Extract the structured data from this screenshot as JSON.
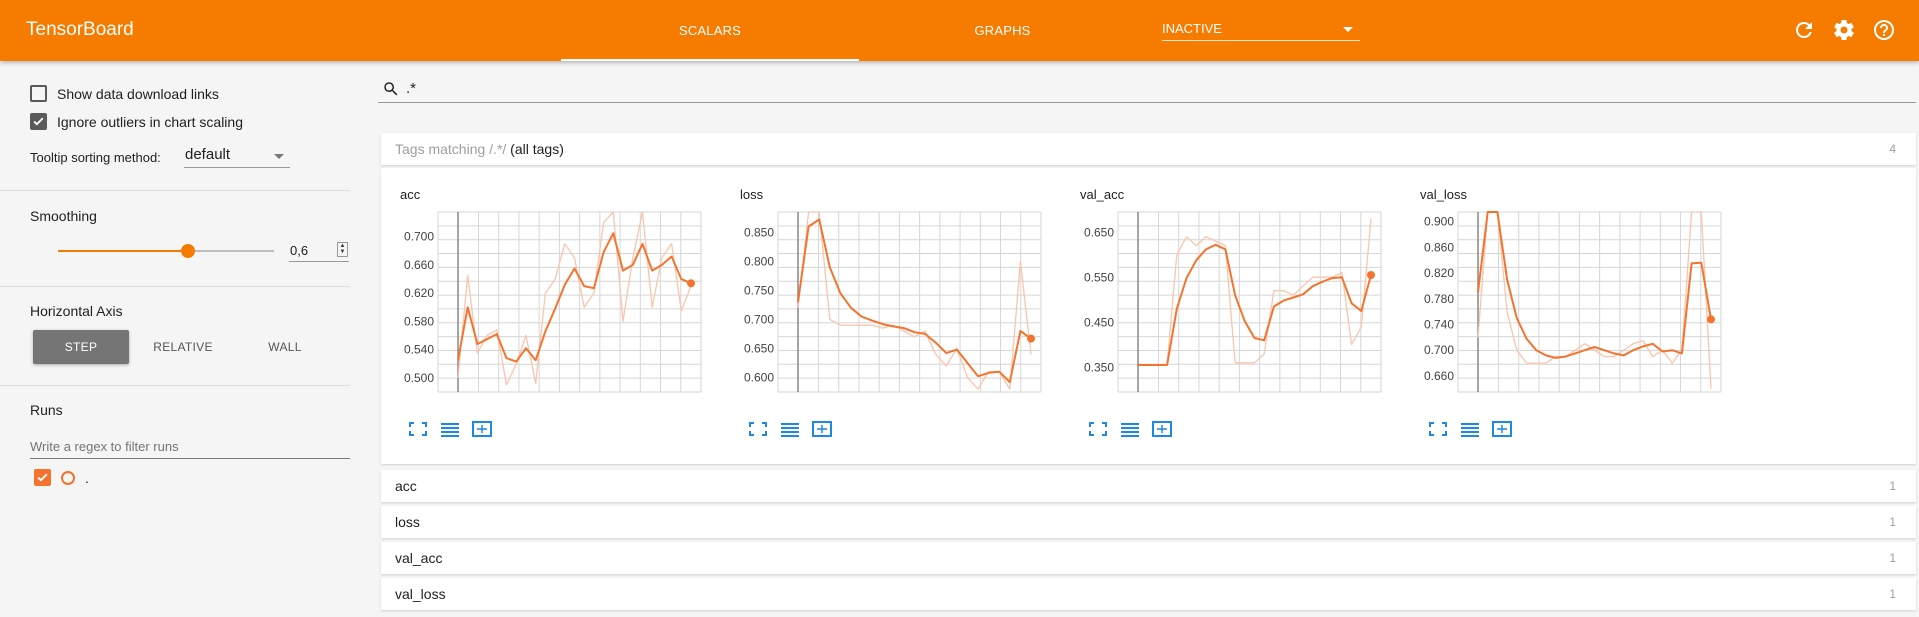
{
  "app": {
    "title": "TensorBoard"
  },
  "nav": {
    "tabs": [
      {
        "label": "SCALARS",
        "active": true
      },
      {
        "label": "GRAPHS",
        "active": false
      }
    ],
    "inactive_select": "INACTIVE",
    "icons": [
      "refresh-icon",
      "settings-icon",
      "help-icon"
    ]
  },
  "colors": {
    "brand": "#f57c00",
    "series": "#f4742f",
    "series_raw": "#fbc4ac"
  },
  "sidebar": {
    "show_download_links": {
      "label": "Show data download links",
      "checked": false
    },
    "ignore_outliers": {
      "label": "Ignore outliers in chart scaling",
      "checked": true
    },
    "tooltip_sorting": {
      "label": "Tooltip sorting method:",
      "value": "default"
    },
    "smoothing": {
      "label": "Smoothing",
      "value": "0,6",
      "fraction": 0.6
    },
    "horizontal_axis": {
      "label": "Horizontal Axis",
      "options": [
        "STEP",
        "RELATIVE",
        "WALL"
      ],
      "selected": "STEP"
    },
    "runs": {
      "label": "Runs",
      "filter_placeholder": "Write a regex to filter runs",
      "items": [
        {
          "name": ".",
          "checked": true
        }
      ]
    }
  },
  "main": {
    "search": ".*",
    "tags_header": {
      "prefix": "Tags matching ",
      "regex": "/.*/",
      "suffix": " (all tags)",
      "count": "4"
    },
    "categories": [
      {
        "name": "acc",
        "count": "1"
      },
      {
        "name": "loss",
        "count": "1"
      },
      {
        "name": "val_acc",
        "count": "1"
      },
      {
        "name": "val_loss",
        "count": "1"
      }
    ]
  },
  "chart_data": [
    {
      "type": "line",
      "title": "acc",
      "yticks": [
        "0.700",
        "0.660",
        "0.620",
        "0.580",
        "0.540",
        "0.500"
      ],
      "ylim": [
        0.48,
        0.735
      ],
      "series": [
        {
          "values": [
            0.525,
            0.6,
            0.548,
            0.555,
            0.562,
            0.528,
            0.523,
            0.542,
            0.525,
            0.566,
            0.598,
            0.632,
            0.655,
            0.63,
            0.627,
            0.678,
            0.705,
            0.652,
            0.66,
            0.69,
            0.652,
            0.66,
            0.672,
            0.64,
            0.634
          ]
        },
        {
          "values": [
            0.5,
            0.645,
            0.535,
            0.56,
            0.568,
            0.49,
            0.52,
            0.56,
            0.492,
            0.62,
            0.64,
            0.69,
            0.67,
            0.6,
            0.62,
            0.72,
            0.735,
            0.58,
            0.67,
            0.735,
            0.6,
            0.67,
            0.69,
            0.595,
            0.63
          ]
        }
      ]
    },
    {
      "type": "line",
      "title": "loss",
      "yticks": [
        "0.850",
        "0.800",
        "0.750",
        "0.700",
        "0.650",
        "0.600"
      ],
      "ylim": [
        0.575,
        0.885
      ],
      "series": [
        {
          "values": [
            0.73,
            0.86,
            0.872,
            0.79,
            0.745,
            0.72,
            0.705,
            0.698,
            0.692,
            0.688,
            0.685,
            0.678,
            0.675,
            0.66,
            0.642,
            0.648,
            0.625,
            0.602,
            0.608,
            0.61,
            0.592,
            0.68,
            0.667
          ]
        },
        {
          "values": [
            0.72,
            0.885,
            0.885,
            0.7,
            0.69,
            0.69,
            0.69,
            0.69,
            0.685,
            0.69,
            0.68,
            0.67,
            0.68,
            0.64,
            0.62,
            0.65,
            0.6,
            0.58,
            0.61,
            0.61,
            0.58,
            0.8,
            0.64
          ]
        }
      ]
    },
    {
      "type": "line",
      "title": "val_acc",
      "yticks": [
        "0.650",
        "0.550",
        "0.450",
        "0.350"
      ],
      "ylim": [
        0.295,
        0.695
      ],
      "series": [
        {
          "values": [
            0.355,
            0.355,
            0.355,
            0.355,
            0.48,
            0.548,
            0.588,
            0.612,
            0.622,
            0.612,
            0.51,
            0.452,
            0.415,
            0.41,
            0.485,
            0.498,
            0.505,
            0.512,
            0.53,
            0.54,
            0.548,
            0.55,
            0.492,
            0.475,
            0.555
          ]
        },
        {
          "values": [
            0.355,
            0.355,
            0.355,
            0.355,
            0.6,
            0.64,
            0.62,
            0.64,
            0.63,
            0.62,
            0.36,
            0.36,
            0.36,
            0.38,
            0.52,
            0.52,
            0.51,
            0.53,
            0.55,
            0.55,
            0.55,
            0.56,
            0.4,
            0.44,
            0.68
          ]
        }
      ]
    },
    {
      "type": "line",
      "title": "val_loss",
      "yticks": [
        "0.900",
        "0.860",
        "0.820",
        "0.780",
        "0.740",
        "0.700",
        "0.660"
      ],
      "ylim": [
        0.635,
        0.915
      ],
      "series": [
        {
          "values": [
            0.79,
            0.915,
            0.915,
            0.81,
            0.75,
            0.718,
            0.7,
            0.692,
            0.688,
            0.69,
            0.695,
            0.7,
            0.705,
            0.7,
            0.695,
            0.692,
            0.7,
            0.706,
            0.71,
            0.698,
            0.7,
            0.695,
            0.835,
            0.836,
            0.748
          ]
        },
        {
          "values": [
            0.72,
            0.915,
            0.915,
            0.76,
            0.7,
            0.68,
            0.68,
            0.68,
            0.69,
            0.69,
            0.7,
            0.71,
            0.7,
            0.69,
            0.69,
            0.7,
            0.71,
            0.715,
            0.69,
            0.7,
            0.68,
            0.7,
            0.915,
            0.915,
            0.64
          ]
        }
      ]
    }
  ]
}
